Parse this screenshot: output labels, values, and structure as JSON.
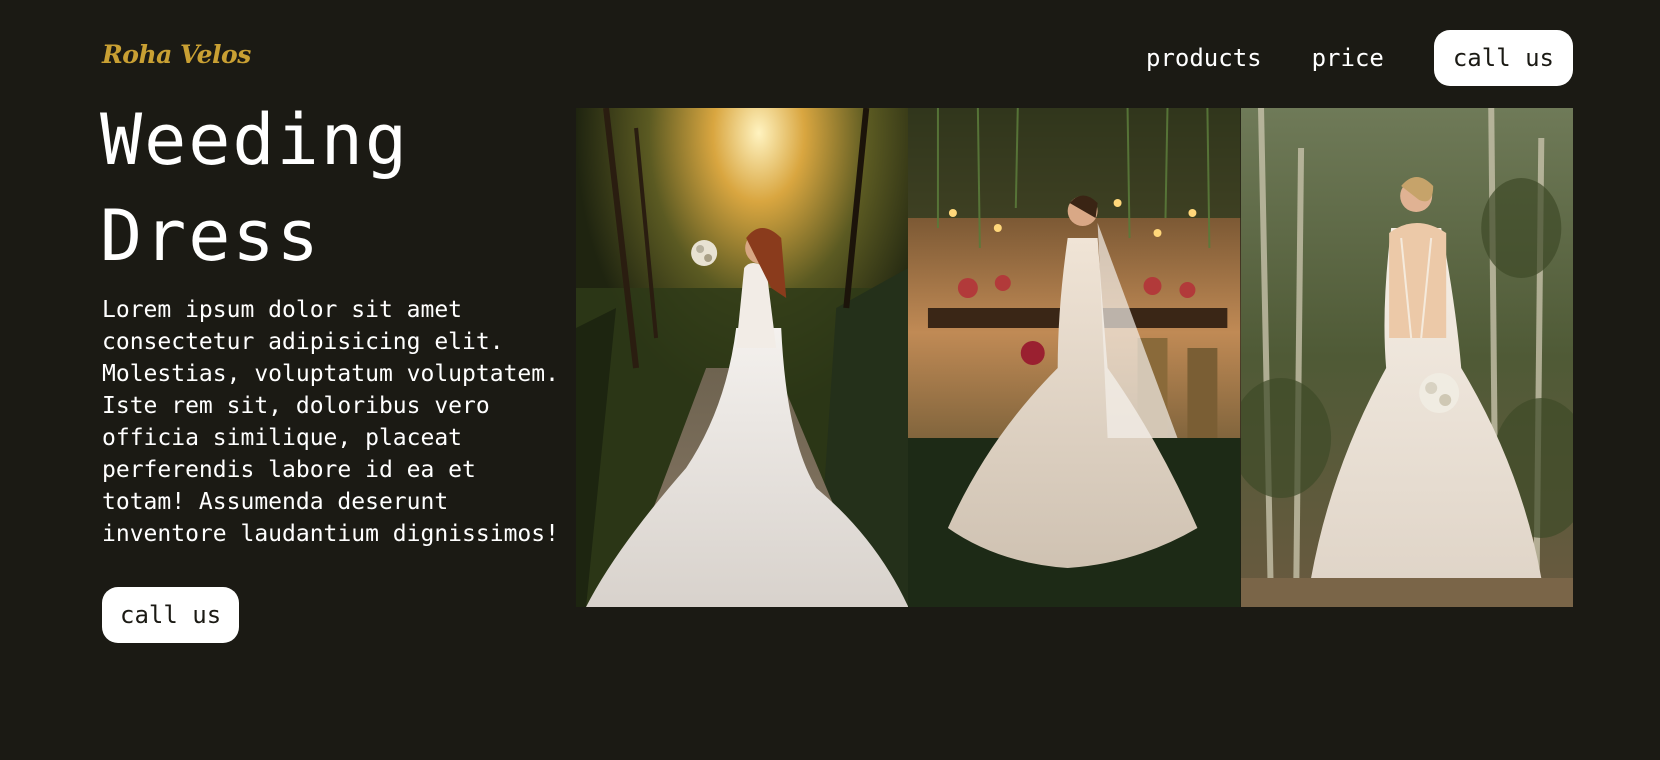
{
  "brand": {
    "logo_text": "Roha Velos",
    "logo_color": "#c9a033"
  },
  "nav": {
    "links": [
      "products",
      "price"
    ],
    "cta_label": "call us"
  },
  "hero": {
    "title_line1": "Weeding",
    "title_line2": "Dress",
    "description": "Lorem ipsum dolor sit amet consectetur adipisicing elit. Molestias, voluptatum voluptatem. Iste rem sit, doloribus vero officia similique, placeat perferendis labore id ea et totam! Assumenda deserunt inventore laudantium dignissimos!",
    "cta_label": "call us"
  },
  "gallery": [
    {
      "subject": "bride in white gown on a forest path"
    },
    {
      "subject": "bride in lace gown beside a decorated dessert table"
    },
    {
      "subject": "bride in lace gown holding a bouquet among trees"
    }
  ],
  "colors": {
    "background": "#1b1a14",
    "text": "#ffffff",
    "button_bg": "#ffffff",
    "button_text": "#1b1a14"
  }
}
